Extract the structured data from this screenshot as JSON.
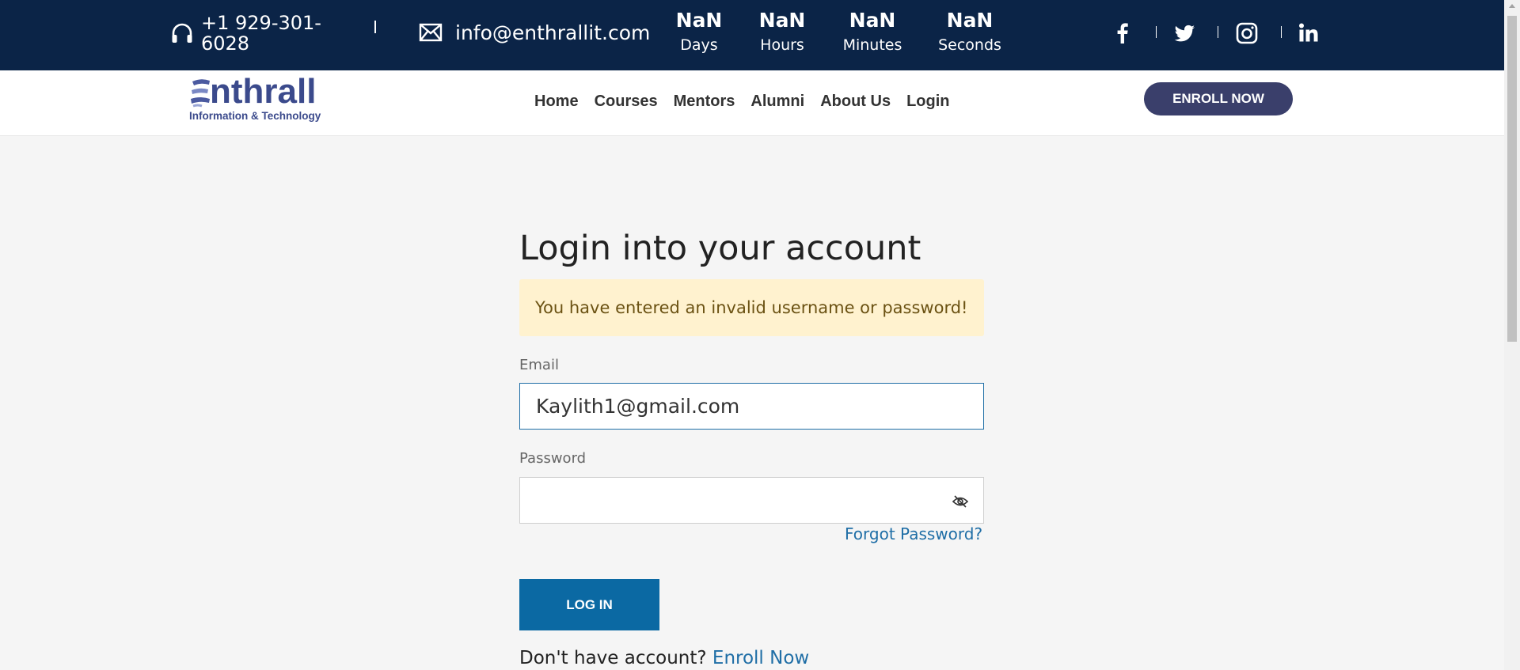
{
  "topbar": {
    "phone": "+1 929-301-6028",
    "email": "info@enthrallit.com",
    "countdown": [
      {
        "value": "NaN",
        "label": "Days"
      },
      {
        "value": "NaN",
        "label": "Hours"
      },
      {
        "value": "NaN",
        "label": "Minutes"
      },
      {
        "value": "NaN",
        "label": "Seconds"
      }
    ],
    "social": [
      "facebook-icon",
      "twitter-icon",
      "instagram-icon",
      "linkedin-icon"
    ]
  },
  "nav": {
    "logo_text": "Enthrall",
    "logo_sub": "Information & Technology",
    "links": [
      "Home",
      "Courses",
      "Mentors",
      "Alumni",
      "About Us",
      "Login"
    ],
    "enroll_label": "ENROLL NOW"
  },
  "login": {
    "title": "Login into your account",
    "error": "You have entered an invalid username or password!",
    "email_label": "Email",
    "email_value": "Kaylith1@gmail.com",
    "password_label": "Password",
    "password_value": "",
    "forgot_label": "Forgot Password?",
    "button_label": "LOG IN",
    "signup_prompt": "Don't have account?",
    "signup_link": "Enroll Now"
  },
  "colors": {
    "topbar_bg": "#0b2447",
    "accent": "#0b69a3",
    "enroll_bg": "#3a3f6b",
    "alert_bg": "#fff2cf"
  }
}
